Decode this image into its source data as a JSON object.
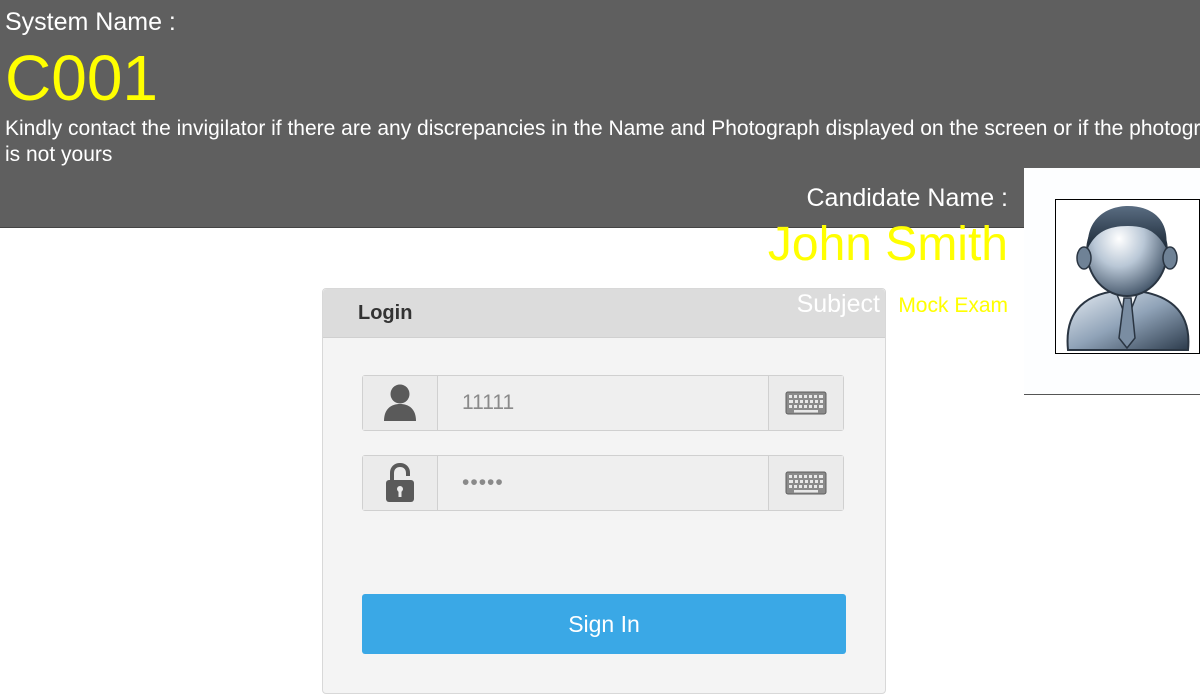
{
  "header": {
    "system_label": "System Name :",
    "system_value": "C001",
    "notice": "Kindly contact the invigilator if there are any discrepancies in the Name and Photograph displayed on the screen or if the photograph is not yours"
  },
  "candidate": {
    "name_label": "Candidate Name :",
    "name_value": "John Smith",
    "subject_label": "Subject :",
    "subject_value": "Mock Exam",
    "photo_icon": "user-avatar-icon"
  },
  "login": {
    "title": "Login",
    "username": {
      "value": "11111",
      "icon": "user-icon",
      "keyboard_icon": "keyboard-icon"
    },
    "password": {
      "value": "•••••",
      "icon": "lock-icon",
      "keyboard_icon": "keyboard-icon"
    },
    "submit_label": "Sign In"
  },
  "colors": {
    "header_bg": "#5f5f5f",
    "highlight": "#ffff00",
    "button": "#3aa8e6"
  }
}
